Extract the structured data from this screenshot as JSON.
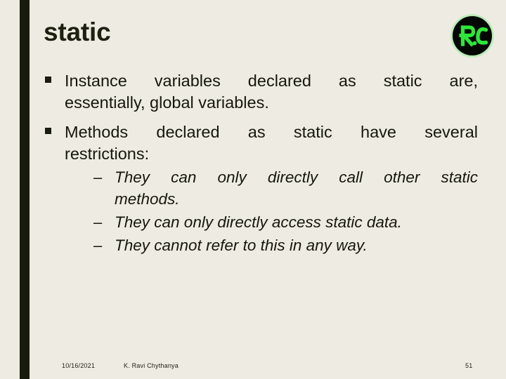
{
  "slide": {
    "title": "static",
    "background_color": "#eeebe3",
    "accent_bar_color": "#181b0d",
    "text_color": "#15170c"
  },
  "logo": {
    "name": "rc-logo",
    "text": "Ʀ.C",
    "letter_color": "#2fe63a",
    "disc_color": "#050704",
    "glow_color": "#28eb37"
  },
  "bullets": [
    {
      "marker": "square-bullet",
      "lines": [
        "Instance variables declared as static are,",
        "essentially, global variables."
      ],
      "full_text": "Instance variables declared as static are, essentially, global variables."
    },
    {
      "marker": "square-bullet",
      "lines": [
        "Methods declared as static have several",
        "restrictions:"
      ],
      "full_text": "Methods declared as static have several restrictions:"
    }
  ],
  "sub_bullets": [
    {
      "marker": "–",
      "lines": [
        "They can only directly call other static",
        "methods."
      ],
      "full_text": "They can only directly call other static methods."
    },
    {
      "marker": "–",
      "lines": [
        "They can only directly access static data."
      ],
      "full_text": "They can only directly access static data."
    },
    {
      "marker": "–",
      "lines": [
        "They cannot refer to this in any way."
      ],
      "full_text": "They cannot refer to this in any way."
    }
  ],
  "footer": {
    "date": "10/16/2021",
    "author": "K. Ravi Chythanya",
    "page_number": "51"
  }
}
